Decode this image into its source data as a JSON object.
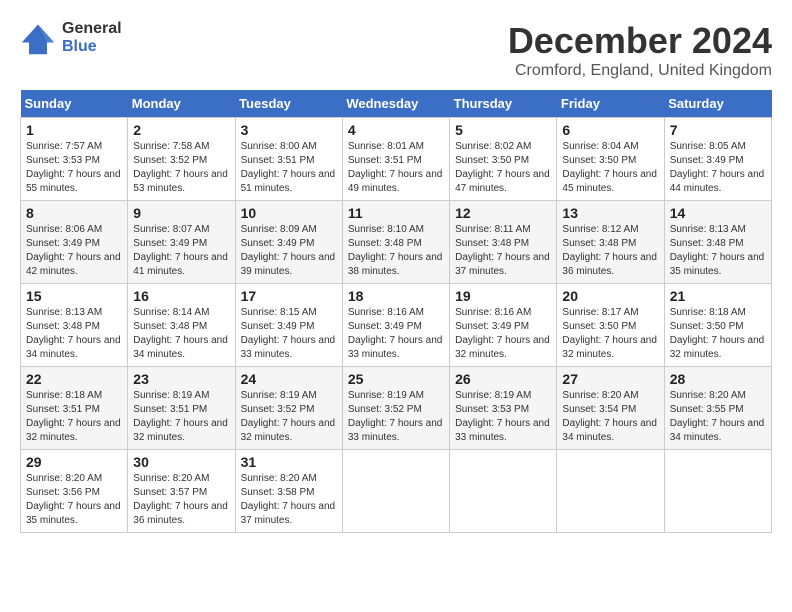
{
  "logo": {
    "line1": "General",
    "line2": "Blue"
  },
  "header": {
    "month": "December 2024",
    "location": "Cromford, England, United Kingdom"
  },
  "weekdays": [
    "Sunday",
    "Monday",
    "Tuesday",
    "Wednesday",
    "Thursday",
    "Friday",
    "Saturday"
  ],
  "weeks": [
    [
      {
        "day": "1",
        "sunrise": "7:57 AM",
        "sunset": "3:53 PM",
        "daylight": "7 hours and 55 minutes."
      },
      {
        "day": "2",
        "sunrise": "7:58 AM",
        "sunset": "3:52 PM",
        "daylight": "7 hours and 53 minutes."
      },
      {
        "day": "3",
        "sunrise": "8:00 AM",
        "sunset": "3:51 PM",
        "daylight": "7 hours and 51 minutes."
      },
      {
        "day": "4",
        "sunrise": "8:01 AM",
        "sunset": "3:51 PM",
        "daylight": "7 hours and 49 minutes."
      },
      {
        "day": "5",
        "sunrise": "8:02 AM",
        "sunset": "3:50 PM",
        "daylight": "7 hours and 47 minutes."
      },
      {
        "day": "6",
        "sunrise": "8:04 AM",
        "sunset": "3:50 PM",
        "daylight": "7 hours and 45 minutes."
      },
      {
        "day": "7",
        "sunrise": "8:05 AM",
        "sunset": "3:49 PM",
        "daylight": "7 hours and 44 minutes."
      }
    ],
    [
      {
        "day": "8",
        "sunrise": "8:06 AM",
        "sunset": "3:49 PM",
        "daylight": "7 hours and 42 minutes."
      },
      {
        "day": "9",
        "sunrise": "8:07 AM",
        "sunset": "3:49 PM",
        "daylight": "7 hours and 41 minutes."
      },
      {
        "day": "10",
        "sunrise": "8:09 AM",
        "sunset": "3:49 PM",
        "daylight": "7 hours and 39 minutes."
      },
      {
        "day": "11",
        "sunrise": "8:10 AM",
        "sunset": "3:48 PM",
        "daylight": "7 hours and 38 minutes."
      },
      {
        "day": "12",
        "sunrise": "8:11 AM",
        "sunset": "3:48 PM",
        "daylight": "7 hours and 37 minutes."
      },
      {
        "day": "13",
        "sunrise": "8:12 AM",
        "sunset": "3:48 PM",
        "daylight": "7 hours and 36 minutes."
      },
      {
        "day": "14",
        "sunrise": "8:13 AM",
        "sunset": "3:48 PM",
        "daylight": "7 hours and 35 minutes."
      }
    ],
    [
      {
        "day": "15",
        "sunrise": "8:13 AM",
        "sunset": "3:48 PM",
        "daylight": "7 hours and 34 minutes."
      },
      {
        "day": "16",
        "sunrise": "8:14 AM",
        "sunset": "3:48 PM",
        "daylight": "7 hours and 34 minutes."
      },
      {
        "day": "17",
        "sunrise": "8:15 AM",
        "sunset": "3:49 PM",
        "daylight": "7 hours and 33 minutes."
      },
      {
        "day": "18",
        "sunrise": "8:16 AM",
        "sunset": "3:49 PM",
        "daylight": "7 hours and 33 minutes."
      },
      {
        "day": "19",
        "sunrise": "8:16 AM",
        "sunset": "3:49 PM",
        "daylight": "7 hours and 32 minutes."
      },
      {
        "day": "20",
        "sunrise": "8:17 AM",
        "sunset": "3:50 PM",
        "daylight": "7 hours and 32 minutes."
      },
      {
        "day": "21",
        "sunrise": "8:18 AM",
        "sunset": "3:50 PM",
        "daylight": "7 hours and 32 minutes."
      }
    ],
    [
      {
        "day": "22",
        "sunrise": "8:18 AM",
        "sunset": "3:51 PM",
        "daylight": "7 hours and 32 minutes."
      },
      {
        "day": "23",
        "sunrise": "8:19 AM",
        "sunset": "3:51 PM",
        "daylight": "7 hours and 32 minutes."
      },
      {
        "day": "24",
        "sunrise": "8:19 AM",
        "sunset": "3:52 PM",
        "daylight": "7 hours and 32 minutes."
      },
      {
        "day": "25",
        "sunrise": "8:19 AM",
        "sunset": "3:52 PM",
        "daylight": "7 hours and 33 minutes."
      },
      {
        "day": "26",
        "sunrise": "8:19 AM",
        "sunset": "3:53 PM",
        "daylight": "7 hours and 33 minutes."
      },
      {
        "day": "27",
        "sunrise": "8:20 AM",
        "sunset": "3:54 PM",
        "daylight": "7 hours and 34 minutes."
      },
      {
        "day": "28",
        "sunrise": "8:20 AM",
        "sunset": "3:55 PM",
        "daylight": "7 hours and 34 minutes."
      }
    ],
    [
      {
        "day": "29",
        "sunrise": "8:20 AM",
        "sunset": "3:56 PM",
        "daylight": "7 hours and 35 minutes."
      },
      {
        "day": "30",
        "sunrise": "8:20 AM",
        "sunset": "3:57 PM",
        "daylight": "7 hours and 36 minutes."
      },
      {
        "day": "31",
        "sunrise": "8:20 AM",
        "sunset": "3:58 PM",
        "daylight": "7 hours and 37 minutes."
      },
      null,
      null,
      null,
      null
    ]
  ],
  "labels": {
    "sunrise": "Sunrise:",
    "sunset": "Sunset:",
    "daylight": "Daylight:"
  }
}
